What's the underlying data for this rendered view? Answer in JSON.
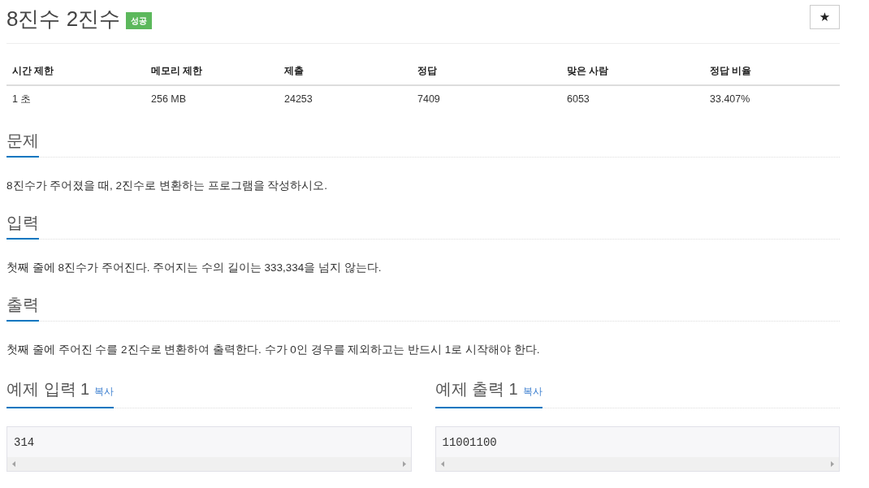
{
  "problem": {
    "title": "8진수 2진수",
    "badge": "성공",
    "star_button": "★"
  },
  "info_table": {
    "columns": [
      "시간 제한",
      "메모리 제한",
      "제출",
      "정답",
      "맞은 사람",
      "정답 비율"
    ],
    "rows": [
      [
        "1 초",
        "256 MB",
        "24253",
        "7409",
        "6053",
        "33.407%"
      ]
    ]
  },
  "sections": [
    {
      "heading": "문제",
      "text": "8진수가 주어졌을 때, 2진수로 변환하는 프로그램을 작성하시오."
    },
    {
      "heading": "입력",
      "text": "첫째 줄에 8진수가 주어진다. 주어지는 수의 길이는 333,334을 넘지 않는다."
    },
    {
      "heading": "출력",
      "text": "첫째 줄에 주어진 수를 2진수로 변환하여 출력한다. 수가 0인 경우를 제외하고는 반드시 1로 시작해야 한다."
    }
  ],
  "samples": [
    {
      "heading": "예제 입력 1",
      "copy_link": "복사",
      "content": "314"
    },
    {
      "heading": "예제 출력 1",
      "copy_link": "복사",
      "content": "11001100"
    }
  ]
}
